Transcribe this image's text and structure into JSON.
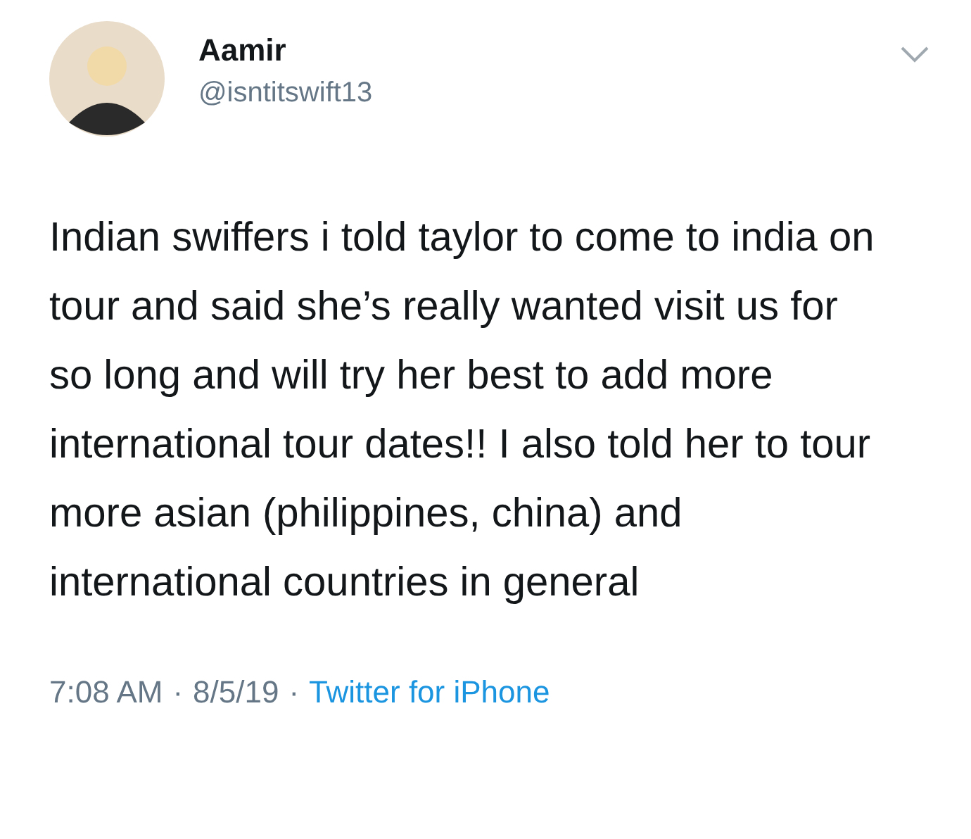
{
  "author": {
    "name": "Aamir",
    "handle": "@isntitswift13"
  },
  "body": "Indian swiffers i told taylor to come to india on tour and said she’s really wanted visit us for so long and will try her best to add more international tour dates!! I also told her to tour more asian (philippines, china) and international countries in general",
  "footer": [
    {
      "kind": "text",
      "text": "7:08 AM"
    },
    {
      "kind": "sep",
      "text": "·"
    },
    {
      "kind": "text",
      "text": "8/5/19"
    },
    {
      "kind": "sep",
      "text": "·"
    },
    {
      "kind": "link",
      "text": "Twitter for iPhone"
    }
  ]
}
